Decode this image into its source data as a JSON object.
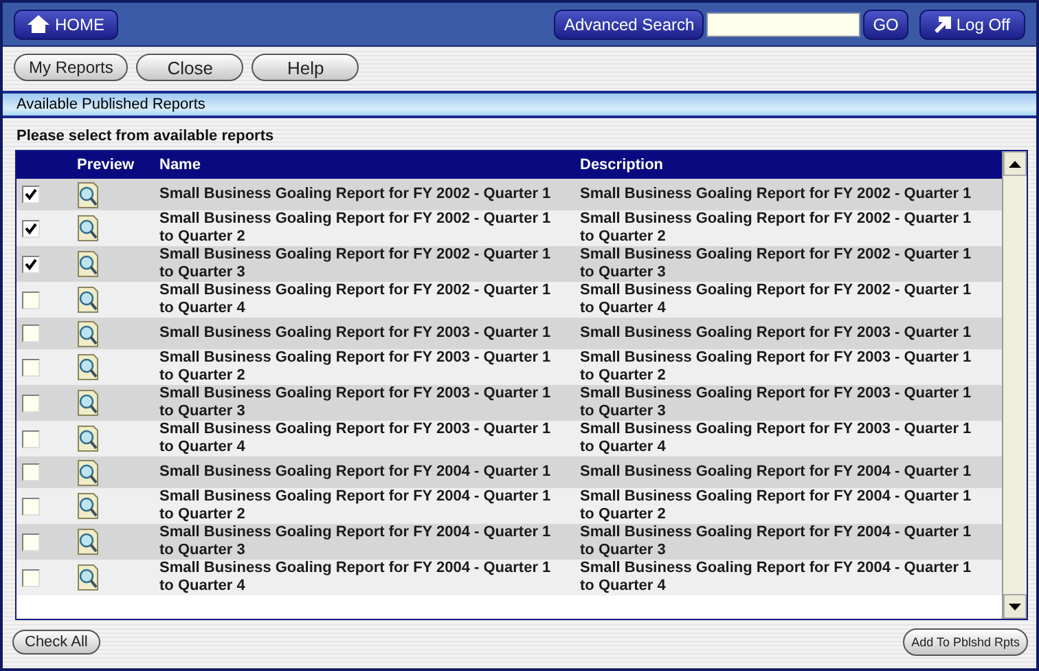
{
  "header": {
    "home": "HOME",
    "advanced_search": "Advanced Search",
    "go": "GO",
    "log_off": "Log Off"
  },
  "toolbar": [
    "My Reports",
    "Close",
    "Help"
  ],
  "section_title": "Available Published Reports",
  "instruction": "Please select from available reports",
  "table": {
    "columns": [
      "Preview",
      "Name",
      "Description"
    ],
    "rows": [
      {
        "checked": true,
        "name": "Small Business Goaling Report for FY 2002 - Quarter 1",
        "description": "Small Business Goaling Report for FY 2002 - Quarter 1"
      },
      {
        "checked": true,
        "name": "Small Business Goaling Report for FY 2002 - Quarter 1\nto Quarter 2",
        "description": "Small Business Goaling Report for FY 2002 - Quarter 1\nto Quarter 2"
      },
      {
        "checked": true,
        "name": "Small Business Goaling Report for FY 2002 - Quarter 1\nto Quarter 3",
        "description": "Small Business Goaling Report for FY 2002 - Quarter 1\nto Quarter 3"
      },
      {
        "checked": false,
        "name": "Small Business Goaling Report for FY 2002 - Quarter 1\nto Quarter 4",
        "description": "Small Business Goaling Report for FY 2002 - Quarter 1\nto Quarter 4"
      },
      {
        "checked": false,
        "name": "Small Business Goaling Report for FY 2003 - Quarter 1",
        "description": "Small Business Goaling Report for FY 2003 - Quarter 1"
      },
      {
        "checked": false,
        "name": "Small Business Goaling Report for FY 2003 - Quarter 1\nto Quarter 2",
        "description": "Small Business Goaling Report for FY 2003 - Quarter 1\nto Quarter 2"
      },
      {
        "checked": false,
        "name": "Small Business Goaling Report for FY 2003 - Quarter 1\nto Quarter 3",
        "description": "Small Business Goaling Report for FY 2003 - Quarter 1\nto Quarter 3"
      },
      {
        "checked": false,
        "name": "Small Business Goaling Report for FY 2003 - Quarter 1\nto Quarter 4",
        "description": "Small Business Goaling Report for FY 2003 - Quarter 1\nto Quarter 4"
      },
      {
        "checked": false,
        "name": "Small Business Goaling Report for FY 2004 - Quarter 1",
        "description": "Small Business Goaling Report for FY 2004 - Quarter 1"
      },
      {
        "checked": false,
        "name": "Small Business Goaling Report for FY 2004 - Quarter 1\nto Quarter 2",
        "description": "Small Business Goaling Report for FY 2004 - Quarter 1\nto Quarter 2"
      },
      {
        "checked": false,
        "name": "Small Business Goaling Report for FY 2004 - Quarter 1\nto Quarter 3",
        "description": "Small Business Goaling Report for FY 2004 - Quarter 1\nto Quarter 3"
      },
      {
        "checked": false,
        "name": "Small Business Goaling Report for FY 2004 - Quarter 1\nto Quarter 4",
        "description": "Small Business Goaling Report for FY 2004 - Quarter 1\nto Quarter 4"
      }
    ]
  },
  "footer": {
    "check_all": "Check All",
    "add": "Add To Pblshd Rpts"
  }
}
